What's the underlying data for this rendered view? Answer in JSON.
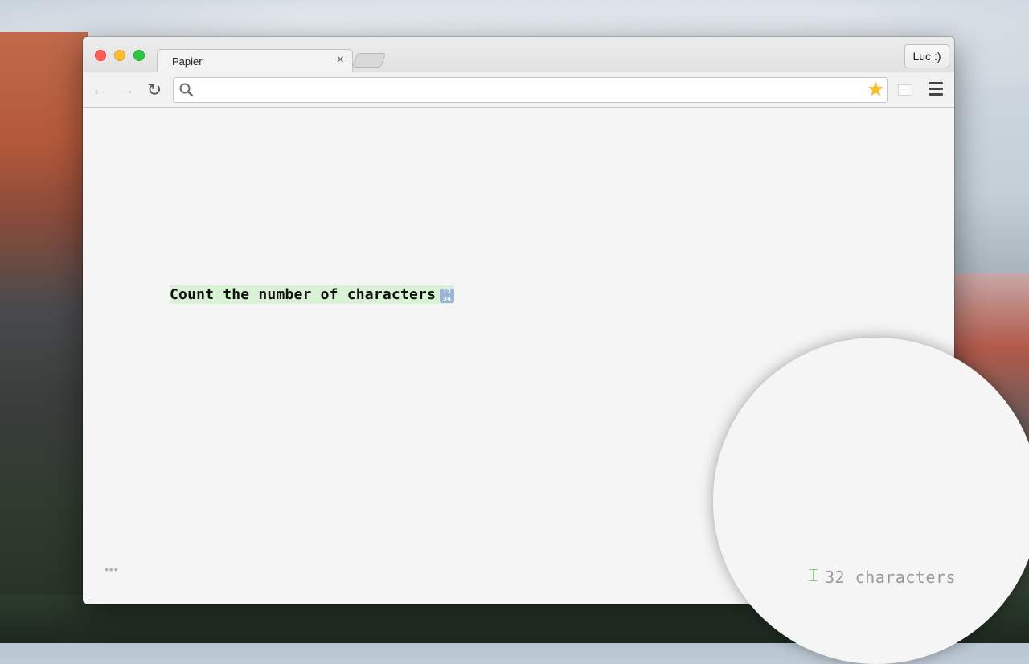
{
  "window": {
    "tab_title": "Papier",
    "tab_close": "×",
    "profile_label": "Luc :)"
  },
  "toolbar": {
    "back_icon": "arrow-left-icon",
    "forward_icon": "arrow-right-icon",
    "reload_icon": "reload-icon",
    "address_placeholder": "",
    "bookmark_icon": "star-icon",
    "menu_icon": "hamburger-menu-icon"
  },
  "document": {
    "text": "Count the number of characters",
    "emoji_label": "1234"
  },
  "footer": {
    "more_label": "•••",
    "char_count": "32 characters"
  },
  "colors": {
    "highlight": "#d9f2d5",
    "cursor_accent": "#7dd36f",
    "star": "#f7c02b"
  }
}
